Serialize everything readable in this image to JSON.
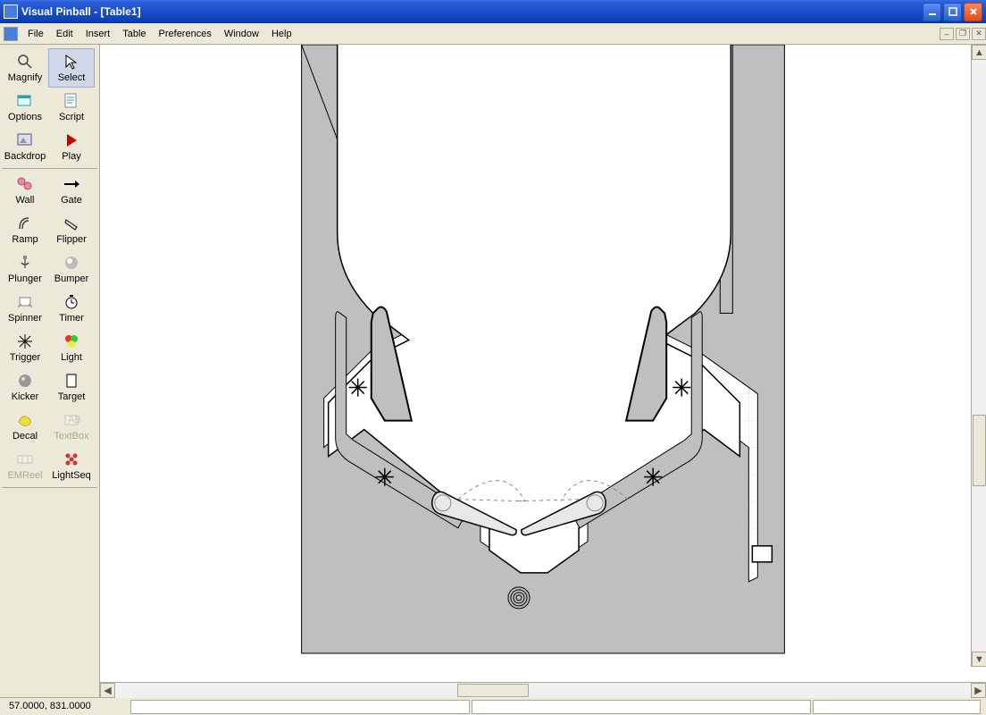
{
  "title": "Visual Pinball - [Table1]",
  "menu": [
    "File",
    "Edit",
    "Insert",
    "Table",
    "Preferences",
    "Window",
    "Help"
  ],
  "tools_group1": [
    {
      "name": "magnify",
      "label": "Magnify",
      "icon": "magnify"
    },
    {
      "name": "select",
      "label": "Select",
      "icon": "select",
      "selected": true
    },
    {
      "name": "options",
      "label": "Options",
      "icon": "options"
    },
    {
      "name": "script",
      "label": "Script",
      "icon": "script"
    },
    {
      "name": "backdrop",
      "label": "Backdrop",
      "icon": "backdrop"
    },
    {
      "name": "play",
      "label": "Play",
      "icon": "play"
    }
  ],
  "tools_group2": [
    {
      "name": "wall",
      "label": "Wall",
      "icon": "wall"
    },
    {
      "name": "gate",
      "label": "Gate",
      "icon": "gate"
    },
    {
      "name": "ramp",
      "label": "Ramp",
      "icon": "ramp"
    },
    {
      "name": "flipper",
      "label": "Flipper",
      "icon": "flipper"
    },
    {
      "name": "plunger",
      "label": "Plunger",
      "icon": "plunger"
    },
    {
      "name": "bumper",
      "label": "Bumper",
      "icon": "bumper"
    },
    {
      "name": "spinner",
      "label": "Spinner",
      "icon": "spinner"
    },
    {
      "name": "timer",
      "label": "Timer",
      "icon": "timer"
    },
    {
      "name": "trigger",
      "label": "Trigger",
      "icon": "trigger"
    },
    {
      "name": "light",
      "label": "Light",
      "icon": "light"
    },
    {
      "name": "kicker",
      "label": "Kicker",
      "icon": "kicker"
    },
    {
      "name": "target",
      "label": "Target",
      "icon": "target"
    },
    {
      "name": "decal",
      "label": "Decal",
      "icon": "decal"
    },
    {
      "name": "textbox",
      "label": "TextBox",
      "icon": "textbox",
      "disabled": true
    },
    {
      "name": "emreel",
      "label": "EMReel",
      "icon": "emreel",
      "disabled": true
    },
    {
      "name": "lightseq",
      "label": "LightSeq",
      "icon": "lightseq"
    }
  ],
  "status": {
    "coords": "57.0000, 831.0000"
  }
}
